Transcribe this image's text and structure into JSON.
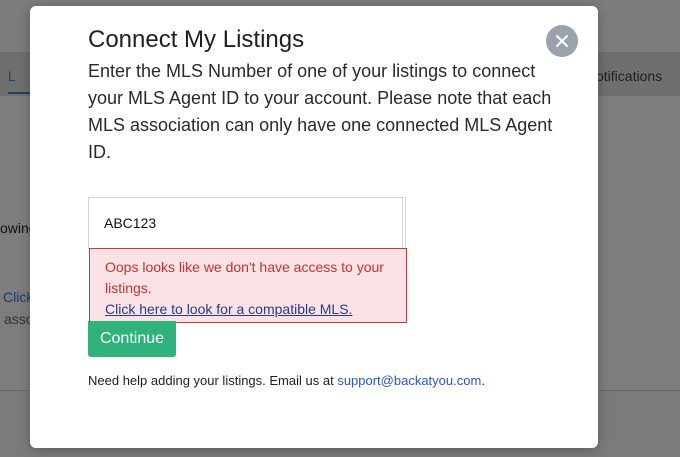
{
  "background": {
    "tab_active_label": "L",
    "tab_right_label": "otifications",
    "text_1": "owing",
    "text_2": "Click",
    "text_3": "asso"
  },
  "modal": {
    "title": "Connect My Listings",
    "description": "Enter the MLS Number of one of your listings to connect your MLS Agent ID to your account. Please note that each MLS association can only have one connected MLS Agent ID.",
    "input": {
      "value": "ABC123",
      "placeholder": ""
    },
    "error": {
      "message": "Oops looks like we don't have access to your listings.",
      "link_text": "Click here to look for a compatible MLS."
    },
    "continue_label": "Continue",
    "help": {
      "text": "Need help adding your listings. Email us at ",
      "email": "support@backatyou.com",
      "suffix": "."
    },
    "close_icon": "close-icon"
  },
  "colors": {
    "accent_green": "#2fb27c",
    "error_red": "#c43333",
    "error_bg": "#fbe3e5",
    "link_blue": "#2a58b6"
  }
}
